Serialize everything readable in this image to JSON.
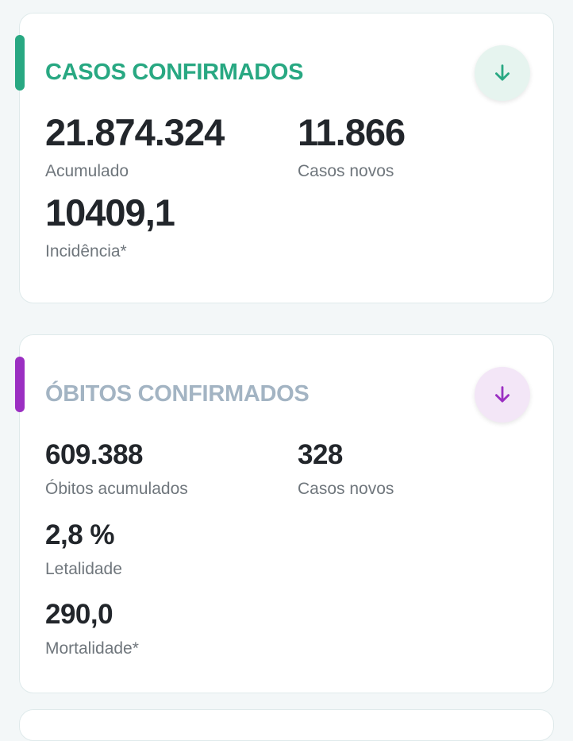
{
  "colors": {
    "casos_accent": "#28a882",
    "casos_button_bg": "#e6f4ef",
    "obitos_accent": "#9b2fc2",
    "obitos_title": "#a3b4c3",
    "obitos_button_bg": "#f3e6f7"
  },
  "casos": {
    "title": "CASOS CONFIRMADOS",
    "download_icon": "arrow-down-icon",
    "acumulado": {
      "value": "21.874.324",
      "label": "Acumulado"
    },
    "casos_novos": {
      "value": "11.866",
      "label": "Casos novos"
    },
    "incidencia": {
      "value": "10409,1",
      "label": "Incidência*"
    }
  },
  "obitos": {
    "title": "ÓBITOS CONFIRMADOS",
    "download_icon": "arrow-down-icon",
    "acumulados": {
      "value": "609.388",
      "label": "Óbitos acumulados"
    },
    "casos_novos": {
      "value": "328",
      "label": "Casos novos"
    },
    "letalidade": {
      "value": "2,8 %",
      "label": "Letalidade"
    },
    "mortalidade": {
      "value": "290,0",
      "label": "Mortalidade*"
    }
  }
}
